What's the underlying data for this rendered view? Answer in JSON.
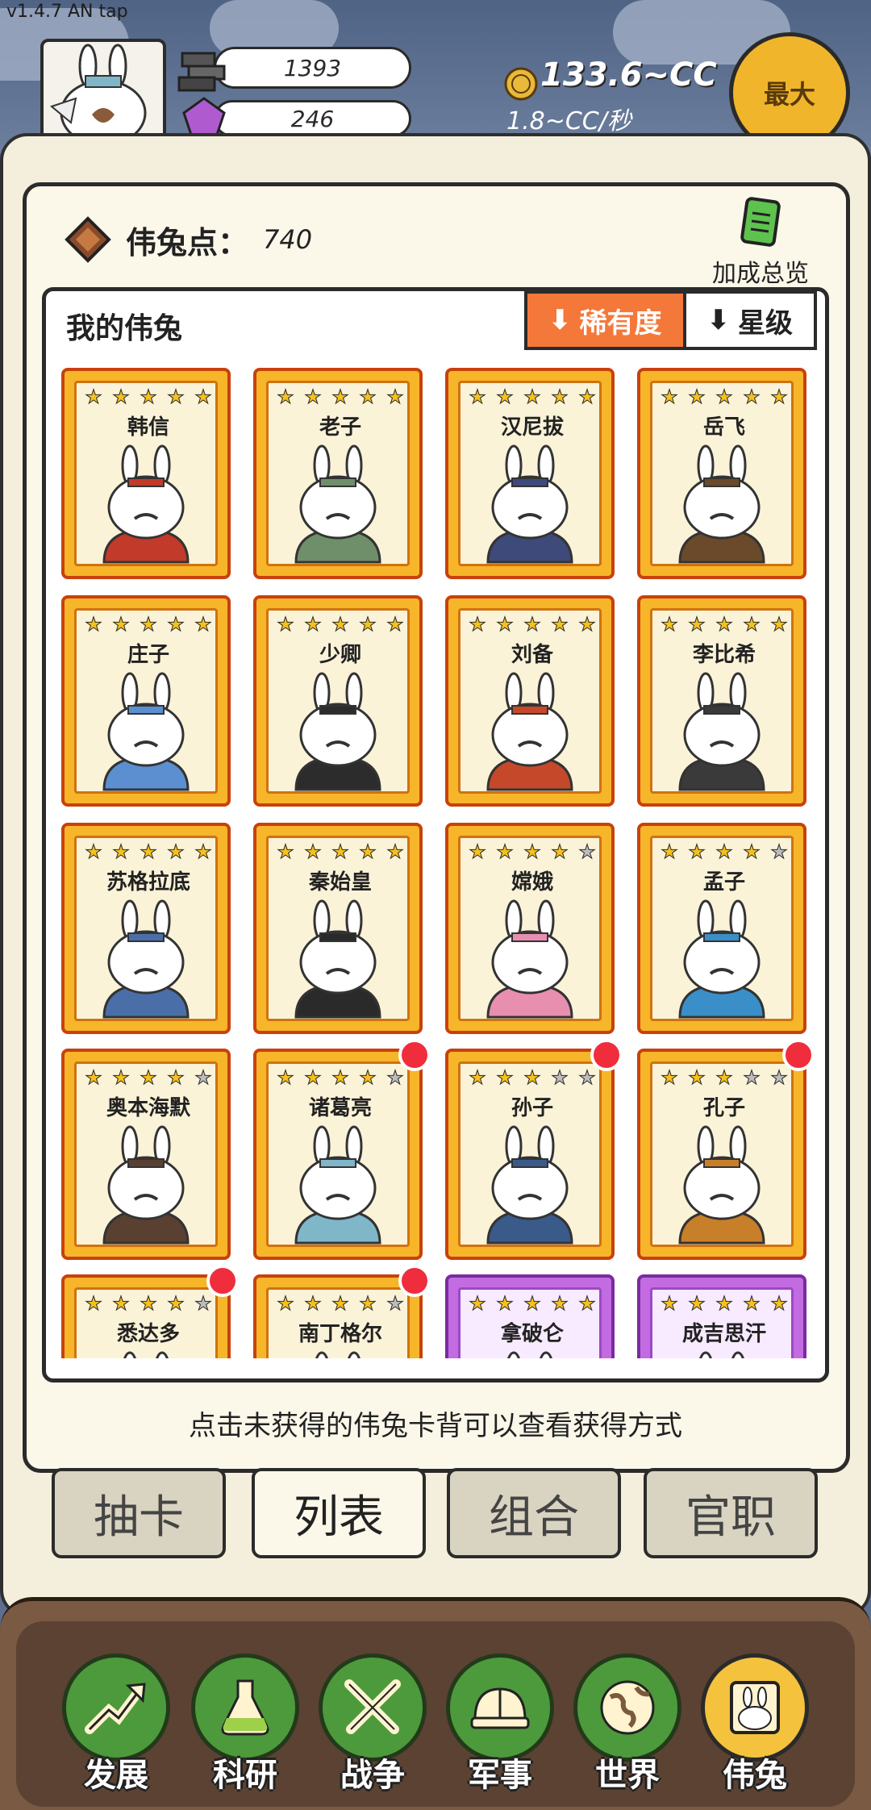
{
  "status": {
    "version": "v1.4.7 AN tap",
    "resource1": "1393",
    "resource2": "246",
    "coins": "133.6~CC",
    "rate": "1.8~CC/秒",
    "max_label": "最大"
  },
  "panel": {
    "points_label": "伟兔点：",
    "points_value": "740",
    "bonus_label": "加成总览",
    "list_title": "我的伟兔",
    "sort_rarity": "稀有度",
    "sort_star": "星级",
    "hint": "点击未获得的伟兔卡背可以查看获得方式"
  },
  "colors": {
    "accent": "#f4783a",
    "card_gold": "#f7b52a",
    "card_purple": "#c36be0",
    "nav_green": "#4d9a3c",
    "nav_active": "#f5c23e",
    "badge_red": "#ef2d3c"
  },
  "cards": [
    {
      "name": "韩信",
      "stars": 5,
      "tier": "gold",
      "badge": false,
      "look": "#c23a2a"
    },
    {
      "name": "老子",
      "stars": 5,
      "tier": "gold",
      "badge": false,
      "look": "#6f8f6a"
    },
    {
      "name": "汉尼拔",
      "stars": 5,
      "tier": "gold",
      "badge": false,
      "look": "#3d4a7a"
    },
    {
      "name": "岳飞",
      "stars": 5,
      "tier": "gold",
      "badge": false,
      "look": "#6a4a2a"
    },
    {
      "name": "庄子",
      "stars": 5,
      "tier": "gold",
      "badge": false,
      "look": "#5b8fd0"
    },
    {
      "name": "少卿",
      "stars": 5,
      "tier": "gold",
      "badge": false,
      "look": "#2c2c2c"
    },
    {
      "name": "刘备",
      "stars": 5,
      "tier": "gold",
      "badge": false,
      "look": "#c6482a"
    },
    {
      "name": "李比希",
      "stars": 5,
      "tier": "gold",
      "badge": false,
      "look": "#3a3a3a"
    },
    {
      "name": "苏格拉底",
      "stars": 5,
      "tier": "gold",
      "badge": false,
      "look": "#4a6fa8"
    },
    {
      "name": "秦始皇",
      "stars": 5,
      "tier": "gold",
      "badge": false,
      "look": "#2a2a2a"
    },
    {
      "name": "嫦娥",
      "stars": 4,
      "tier": "gold",
      "badge": false,
      "look": "#e88fb0"
    },
    {
      "name": "孟子",
      "stars": 4,
      "tier": "gold",
      "badge": false,
      "look": "#3a8fc8"
    },
    {
      "name": "奥本海默",
      "stars": 4,
      "tier": "gold",
      "badge": false,
      "look": "#5a4030"
    },
    {
      "name": "诸葛亮",
      "stars": 4,
      "tier": "gold",
      "badge": true,
      "look": "#7fb6c8"
    },
    {
      "name": "孙子",
      "stars": 3,
      "tier": "gold",
      "badge": true,
      "look": "#3a5a8a"
    },
    {
      "name": "孔子",
      "stars": 3,
      "tier": "gold",
      "badge": true,
      "look": "#c87f2a"
    },
    {
      "name": "悉达多",
      "stars": 4,
      "tier": "gold",
      "badge": true,
      "look": "#e0b040"
    },
    {
      "name": "南丁格尔",
      "stars": 4,
      "tier": "gold",
      "badge": true,
      "look": "#dcdcdc"
    },
    {
      "name": "拿破仑",
      "stars": 5,
      "tier": "purple",
      "badge": false,
      "look": "#2a3a7a"
    },
    {
      "name": "成吉思汗",
      "stars": 5,
      "tier": "purple",
      "badge": false,
      "look": "#7a5a3a"
    }
  ],
  "tabs": [
    {
      "label": "抽卡",
      "active": false
    },
    {
      "label": "列表",
      "active": true
    },
    {
      "label": "组合",
      "active": false
    },
    {
      "label": "官职",
      "active": false
    }
  ],
  "nav": [
    {
      "label": "发展",
      "icon": "growth-arrow-icon",
      "active": false
    },
    {
      "label": "科研",
      "icon": "flask-icon",
      "active": false
    },
    {
      "label": "战争",
      "icon": "crossed-swords-icon",
      "active": false
    },
    {
      "label": "军事",
      "icon": "helmet-icon",
      "active": false
    },
    {
      "label": "世界",
      "icon": "globe-icon",
      "active": false
    },
    {
      "label": "伟兔",
      "icon": "rabbit-portrait-icon",
      "active": true
    }
  ]
}
